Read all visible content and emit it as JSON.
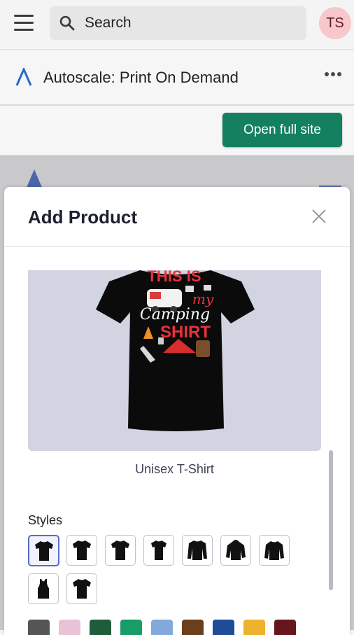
{
  "topbar": {
    "search_placeholder": "Search",
    "avatar_initials": "TS"
  },
  "app": {
    "title": "Autoscale: Print On Demand"
  },
  "actions": {
    "open_full_site": "Open full site"
  },
  "modal": {
    "title": "Add Product",
    "product": {
      "name": "Unisex T-Shirt",
      "image_text": [
        "THIS IS",
        "my",
        "Camping",
        "SHIRT"
      ]
    },
    "styles_label": "Styles",
    "styles": [
      {
        "name": "tshirt",
        "selected": true
      },
      {
        "name": "tshirt",
        "selected": false
      },
      {
        "name": "tshirt",
        "selected": false
      },
      {
        "name": "tshirt",
        "selected": false
      },
      {
        "name": "long-sleeve",
        "selected": false
      },
      {
        "name": "hoodie",
        "selected": false
      },
      {
        "name": "sweatshirt",
        "selected": false
      },
      {
        "name": "tank-top",
        "selected": false
      },
      {
        "name": "tshirt",
        "selected": false
      }
    ],
    "colors": [
      "#555555",
      "#e8c3d6",
      "#1f5c3a",
      "#1a9c68",
      "#85a8dc",
      "#6a3f1e",
      "#1f4c99",
      "#eeb22c",
      "#66171e"
    ]
  },
  "theme": {
    "accent": "#148060",
    "selection": "#5c6ac4",
    "avatar_bg": "#f8c7cb"
  }
}
